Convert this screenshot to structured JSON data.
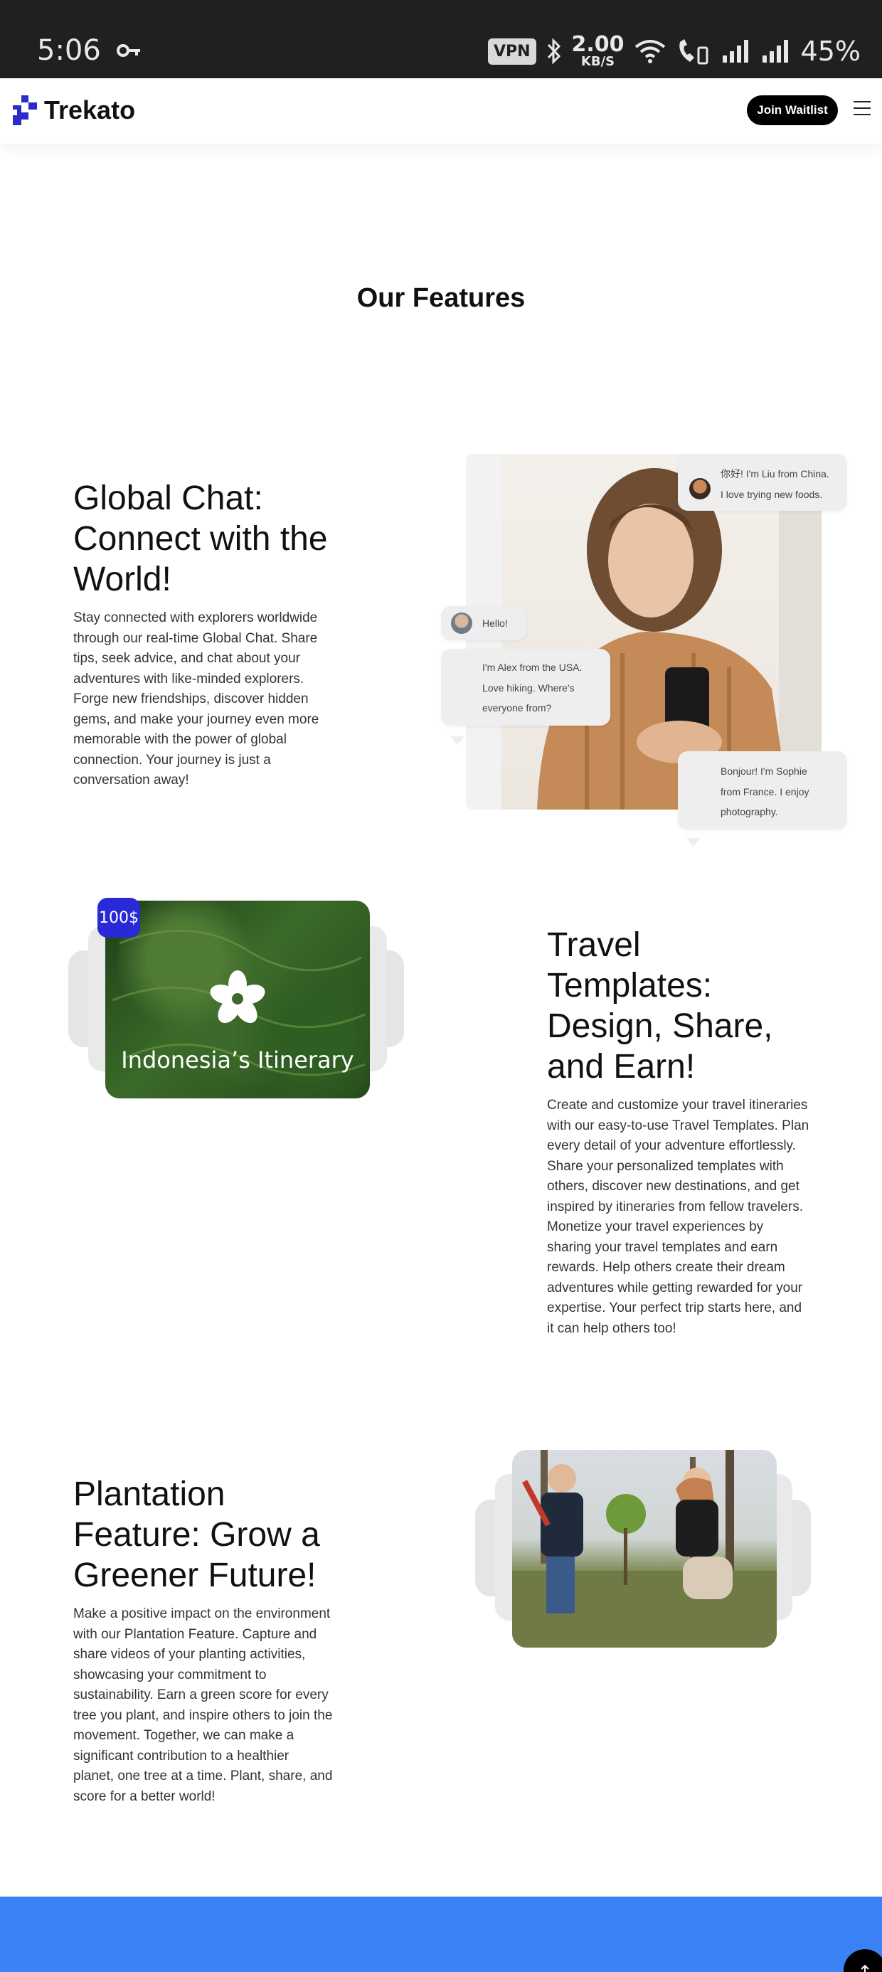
{
  "status_bar": {
    "time": "5:06",
    "vpn": "VPN",
    "speed_value": "2.00",
    "speed_unit": "KB/S",
    "battery": "45%"
  },
  "header": {
    "logo_text": "Trekato",
    "join_label": "Join Waitlist",
    "accent": "#2b2bcc"
  },
  "main": {
    "section_title": "Our Features",
    "features": [
      {
        "title_lines": [
          "Global Chat:",
          "Connect with the",
          "World!"
        ],
        "body_lines": [
          "Stay connected with explorers worldwide",
          "through our real-time Global Chat. Share",
          "tips, seek advice, and chat about your",
          "adventures with like-minded explorers.",
          "Forge new friendships, discover hidden",
          "gems, and make your journey even more",
          "memorable with the power of global",
          "connection. Your journey is just a",
          "conversation away!"
        ],
        "chat_bubbles": [
          {
            "lines": [
              "你好! I'm Liu from China.",
              "I love trying new foods."
            ]
          },
          {
            "lines": [
              "Hello!"
            ]
          },
          {
            "lines": [
              "I'm Alex from the USA.",
              "Love hiking. Where's",
              "everyone from?"
            ]
          },
          {
            "lines": [
              "Bonjour! I'm Sophie",
              "from France. I enjoy",
              "photography."
            ]
          }
        ]
      },
      {
        "title_lines": [
          "Travel",
          "Templates:",
          "Design, Share,",
          "and Earn!"
        ],
        "body_lines": [
          "Create and customize your travel itineraries",
          "with our easy-to-use Travel Templates. Plan",
          "every detail of your adventure effortlessly.",
          "Share your personalized templates with",
          "others, discover new destinations, and get",
          "inspired by itineraries from fellow travelers.",
          "Monetize your travel experiences by",
          "sharing your travel templates and earn",
          "rewards. Help others create their dream",
          "adventures while getting rewarded for your",
          "expertise. Your perfect trip starts here, and",
          "it can help others too!"
        ],
        "card_title": "Indonesia’s Itinerary",
        "price_badge": "100$"
      },
      {
        "title_lines": [
          "Plantation",
          "Feature: Grow a",
          "Greener Future!"
        ],
        "body_lines": [
          "Make a positive impact on the environment",
          "with our Plantation Feature. Capture and",
          "share videos of your planting activities,",
          "showcasing your commitment to",
          "sustainability. Earn a green score for every",
          "tree you plant, and inspire others to join the",
          "movement. Together, we can make a",
          "significant contribution to a healthier",
          "planet, one tree at a time. Plant, share, and",
          "score for a better world!"
        ]
      }
    ]
  },
  "footer": {
    "band_color": "#3b82f6",
    "scroll_top_icon": "arrow-up-icon"
  }
}
